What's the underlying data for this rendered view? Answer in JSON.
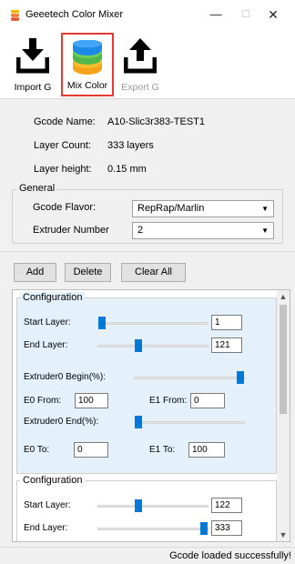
{
  "window": {
    "title": "Geeetech Color Mixer",
    "minimize": "—",
    "maximize": "☐",
    "close": "✕"
  },
  "toolbar": {
    "import_label": "Import G",
    "mix_label": "Mix Color",
    "export_label": "Export G"
  },
  "info": {
    "gcode_name_label": "Gcode Name:",
    "gcode_name_value": "A10-Slic3r383-TEST1",
    "layer_count_label": "Layer Count:",
    "layer_count_value": "333 layers",
    "layer_height_label": "Layer height:",
    "layer_height_value": "0.15 mm"
  },
  "general": {
    "title": "General",
    "flavor_label": "Gcode Flavor:",
    "flavor_value": "RepRap/Marlin",
    "extruder_label": "Extruder Number",
    "extruder_value": "2"
  },
  "actions": {
    "add": "Add",
    "delete": "Delete",
    "clear_all": "Clear All"
  },
  "configs": [
    {
      "title": "Configuration",
      "start_layer_label": "Start Layer:",
      "start_layer_value": "1",
      "start_layer_level": 0.0,
      "end_layer_label": "End Layer:",
      "end_layer_value": "121",
      "end_layer_level": 0.36,
      "e0_begin_label": "Extruder0 Begin(%):",
      "e0_begin_level": 1.0,
      "e0_from_label": "E0 From:",
      "e0_from_value": "100",
      "e1_from_label": "E1 From:",
      "e1_from_value": "0",
      "e0_end_label": "Extruder0 End(%):",
      "e0_end_level": 0.0,
      "e0_to_label": "E0 To:",
      "e0_to_value": "0",
      "e1_to_label": "E1 To:",
      "e1_to_value": "100"
    },
    {
      "title": "Configuration",
      "start_layer_label": "Start Layer:",
      "start_layer_value": "122",
      "start_layer_level": 0.36,
      "end_layer_label": "End Layer:",
      "end_layer_value": "333",
      "end_layer_level": 1.0
    }
  ],
  "status": {
    "message": "Gcode loaded successfully!"
  },
  "colors": {
    "accent": "#0078d7",
    "highlight_border": "#e53935",
    "selected_config_bg": "#e4f1fb"
  }
}
